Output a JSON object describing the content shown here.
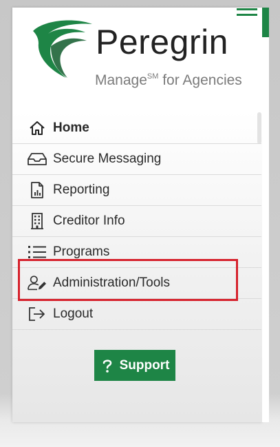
{
  "brand": {
    "name": "Peregrin",
    "tagline_prefix": "Manage",
    "tagline_sup": "SM",
    "tagline_suffix": " for Agencies",
    "green": "#1e8546"
  },
  "menu": {
    "items": [
      {
        "label": "Home",
        "icon": "home-icon",
        "active": true
      },
      {
        "label": "Secure Messaging",
        "icon": "inbox-tray-icon"
      },
      {
        "label": "Reporting",
        "icon": "report-document-icon"
      },
      {
        "label": "Creditor Info",
        "icon": "building-icon"
      },
      {
        "label": "Programs",
        "icon": "list-icon"
      },
      {
        "label": "Administration/Tools",
        "icon": "user-edit-icon",
        "highlighted": true
      },
      {
        "label": "Logout",
        "icon": "logout-icon"
      }
    ]
  },
  "support": {
    "label": "Support",
    "icon": "question-icon"
  },
  "highlight_color": "#d6202b"
}
